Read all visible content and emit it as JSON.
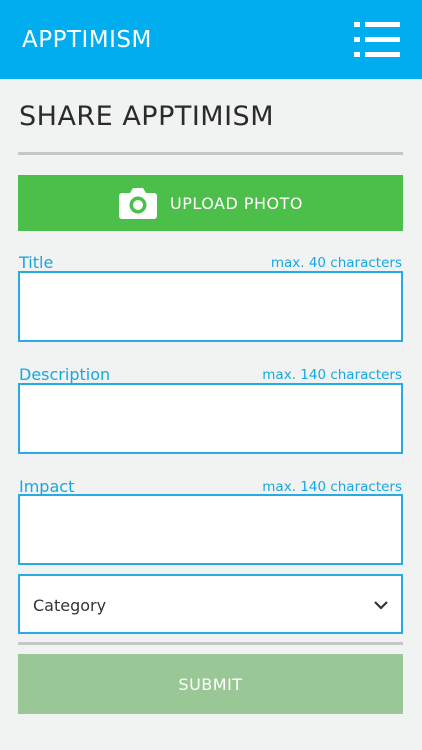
{
  "app": {
    "title": "APPTIMISM",
    "menu_icon": "menu-list-icon",
    "bar_color": "#00aeef"
  },
  "page": {
    "title": "SHARE APPTIMISM"
  },
  "upload": {
    "label": "UPLOAD PHOTO",
    "icon": "camera-icon",
    "color": "#4cbf4b"
  },
  "fields": {
    "title": {
      "label": "Title",
      "hint": "max. 40 characters",
      "value": ""
    },
    "description": {
      "label": "Description",
      "hint": "max. 140 characters",
      "value": ""
    },
    "impact": {
      "label": "Impact",
      "hint": "max. 140 characters",
      "value": ""
    }
  },
  "category": {
    "selected": "Category",
    "icon": "chevron-down-icon"
  },
  "submit": {
    "label": "SUBMIT",
    "color": "#99c795"
  },
  "accent_color": "#29abe2"
}
